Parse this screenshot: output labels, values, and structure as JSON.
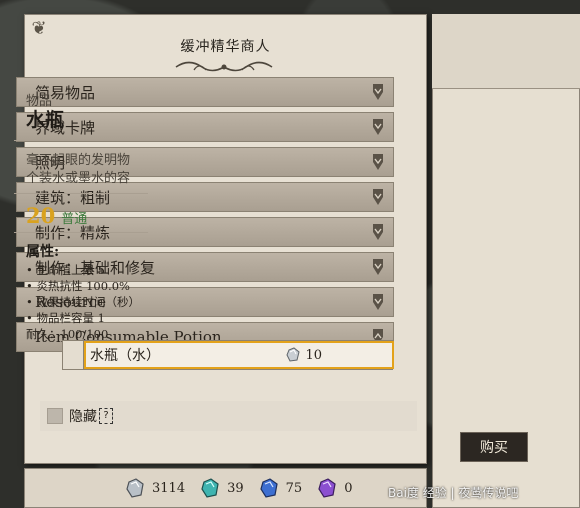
{
  "merchant": {
    "title": "缓冲精华商人",
    "categories": [
      {
        "label": "简易物品",
        "expanded": false
      },
      {
        "label": "界域卡牌",
        "expanded": false
      },
      {
        "label": "照明",
        "expanded": false
      },
      {
        "label": "建筑：粗制",
        "expanded": false
      },
      {
        "label": "制作：精炼",
        "expanded": false
      },
      {
        "label": "制作：基础和修复",
        "expanded": false
      },
      {
        "label": "Resource",
        "expanded": false
      },
      {
        "label": "Item.Consumable.Potion",
        "expanded": true
      }
    ],
    "selected_item": {
      "name": "水瓶（水）",
      "price": "10"
    },
    "hide_label": "隐藏",
    "hide_help": "?"
  },
  "currency": [
    {
      "icon": "crystal-silver-icon",
      "amount": "3114",
      "color": "#9aa3ad"
    },
    {
      "icon": "crystal-teal-icon",
      "amount": "39",
      "color": "#3fb4b0"
    },
    {
      "icon": "crystal-blue-icon",
      "amount": "75",
      "color": "#3d6fd1"
    },
    {
      "icon": "crystal-purple-icon",
      "amount": "0",
      "color": "#8b4fd0"
    }
  ],
  "detail": {
    "type": "物品",
    "name": "水瓶",
    "desc_line1": "毫不起眼的发明物",
    "desc_line2": "个装水或墨水的容",
    "price": "20",
    "quality": "普通",
    "attr_heading": "属性:",
    "attrs": [
      "• 生命值上限  5",
      "• 炎热抗性  100.0%",
      "• 效果持续时间（秒）",
      "• 物品栏容量  1",
      "耐久：100/100"
    ],
    "buy_label": "购买"
  },
  "watermark": "Bai度 经验 | 夜莺传说吧",
  "colors": {
    "accent": "#e3a21a",
    "price": "#d9a21f",
    "quality": "#3c7a3c"
  }
}
